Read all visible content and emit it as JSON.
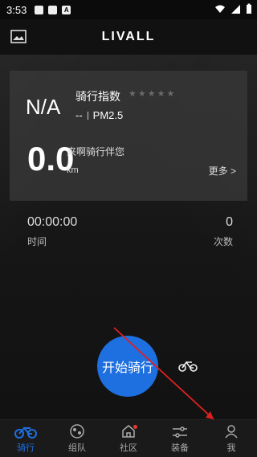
{
  "status": {
    "time": "3:53"
  },
  "header": {
    "brand": "LIVALL"
  },
  "stats": {
    "na": "N/A",
    "ride_index_label": "骑行指数",
    "pm_dash": "--",
    "pm_label": "PM2.5",
    "distance": "0.0",
    "come_ride": "来啊骑行伴您",
    "km": "km",
    "more": "更多 >"
  },
  "summary": {
    "duration_value": "00:00:00",
    "duration_label": "时间",
    "count_value": "0",
    "count_label": "次数"
  },
  "start_button": "开始骑行",
  "tabs": [
    {
      "label": "骑行",
      "icon": "bike-icon",
      "active": true
    },
    {
      "label": "组队",
      "icon": "team-icon"
    },
    {
      "label": "社区",
      "icon": "community-icon"
    },
    {
      "label": "装备",
      "icon": "equipment-icon"
    },
    {
      "label": "我",
      "icon": "profile-icon"
    }
  ],
  "colors": {
    "accent": "#1e6fe0",
    "badge": "#e53935"
  }
}
